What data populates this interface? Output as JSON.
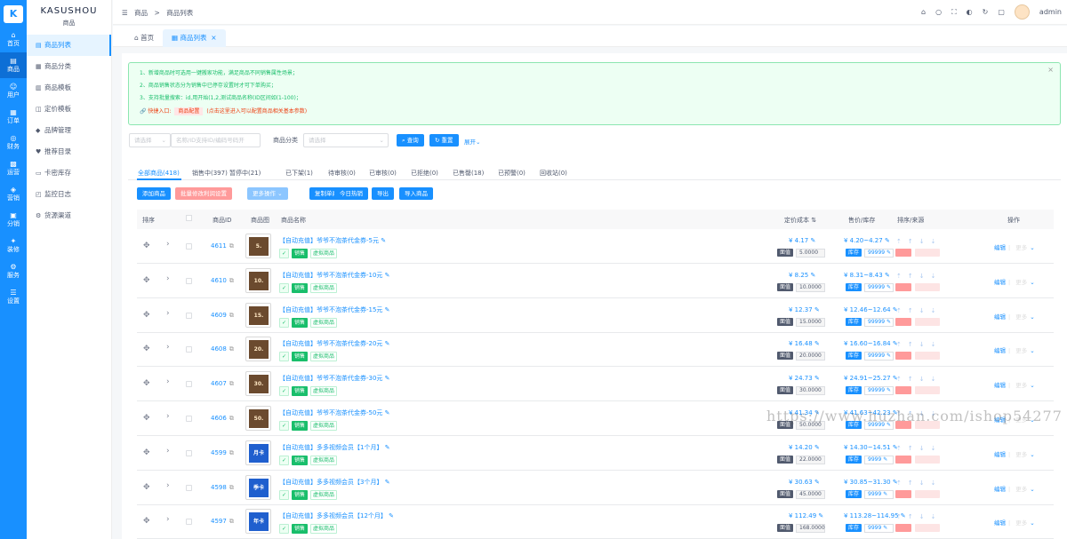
{
  "app": {
    "logo_text": "K",
    "brand": "KASUSHOU",
    "section": "商品"
  },
  "rail": [
    {
      "icon": "⌂",
      "label": "首页"
    },
    {
      "icon": "▤",
      "label": "商品"
    },
    {
      "icon": "☺",
      "label": "用户"
    },
    {
      "icon": "▦",
      "label": "订单"
    },
    {
      "icon": "◎",
      "label": "财务"
    },
    {
      "icon": "▩",
      "label": "运营"
    },
    {
      "icon": "◈",
      "label": "营销"
    },
    {
      "icon": "▣",
      "label": "分销"
    },
    {
      "icon": "✦",
      "label": "装修"
    },
    {
      "icon": "⚙",
      "label": "服务"
    },
    {
      "icon": "☰",
      "label": "设置"
    }
  ],
  "menu": [
    {
      "icon": "▤",
      "label": "商品列表"
    },
    {
      "icon": "▦",
      "label": "商品分类"
    },
    {
      "icon": "▥",
      "label": "商品模板"
    },
    {
      "icon": "◫",
      "label": "定价模板"
    },
    {
      "icon": "◆",
      "label": "品牌管理"
    },
    {
      "icon": "♥",
      "label": "推荐目录"
    },
    {
      "icon": "▭",
      "label": "卡密库存"
    },
    {
      "icon": "◰",
      "label": "监控日志"
    },
    {
      "icon": "⚙",
      "label": "货源渠道"
    }
  ],
  "breadcrumb": {
    "root": "商品",
    "sep": ">",
    "current": "商品列表"
  },
  "user": {
    "name": "admin"
  },
  "tabs": [
    {
      "label": "首页"
    },
    {
      "label": "商品列表",
      "close": "×"
    }
  ],
  "alert": {
    "line1": "1、新增商品时可选用一键搬家功能，满足商品不同销售属性场景；",
    "line2": "2、商品销售状态分为销售中已停存设置时才可下单购买；",
    "line3": "3、支持批量搜索：id,用开始(1,2,测试商品名称(ID区间如(1-100)；",
    "quick_label": "🔗 快捷入口:",
    "quick_link": "商品配置",
    "quick_note": "(点击这里进入可以配置商品相关基本参数)",
    "close": "×"
  },
  "filters": {
    "select1": "请选择",
    "search_placeholder": "名称/ID支持ID/编码号码开",
    "category_label": "商品分类",
    "category_placeholder": "请选择",
    "query": "查询",
    "reset": "重置",
    "expand": "展开"
  },
  "status_tabs": [
    "全部商品(418)",
    "销售中(397)",
    "暂停中(21)",
    "已下架(1)",
    "待审核(0)",
    "已审核(0)",
    "已拒绝(0)",
    "已售罄(18)",
    "已预警(0)",
    "回收站(0)"
  ],
  "actions": [
    "添加商品",
    "批量修改利润设置",
    "更多操作",
    "复制单商",
    "今日热销",
    "导出",
    "导入商品"
  ],
  "table_headers": {
    "sort": "排序",
    "id": "商品ID",
    "image": "商品图",
    "name": "商品名称",
    "cost": "定价成本",
    "price": "售价/库存",
    "source": "排序/来源",
    "ops": "操作"
  },
  "row_labels": {
    "sale_tag": "销售",
    "virtual_tag": "虚拟商品",
    "cost_tag": "面值",
    "stock_tag": "库存",
    "edit": "编辑",
    "more": "更多",
    "copy_icon": "⧉",
    "edit_icon": "✎"
  },
  "rows": [
    {
      "id": "4611",
      "thumb": "5.",
      "thumb_type": "coffee",
      "name": "【自动充值】爷爷不泡茶代金券-5元",
      "cost": "¥ 4.17",
      "face": "5.0000",
      "price": "¥ 4.20~4.27",
      "stock": "99999"
    },
    {
      "id": "4610",
      "thumb": "10.",
      "thumb_type": "coffee",
      "name": "【自动充值】爷爷不泡茶代金券-10元",
      "cost": "¥ 8.25",
      "face": "10.0000",
      "price": "¥ 8.31~8.43",
      "stock": "99999"
    },
    {
      "id": "4609",
      "thumb": "15.",
      "thumb_type": "coffee",
      "name": "【自动充值】爷爷不泡茶代金券-15元",
      "cost": "¥ 12.37",
      "face": "15.0000",
      "price": "¥ 12.46~12.64",
      "stock": "99999"
    },
    {
      "id": "4608",
      "thumb": "20.",
      "thumb_type": "coffee",
      "name": "【自动充值】爷爷不泡茶代金券-20元",
      "cost": "¥ 16.48",
      "face": "20.0000",
      "price": "¥ 16.60~16.84",
      "stock": "99999"
    },
    {
      "id": "4607",
      "thumb": "30.",
      "thumb_type": "coffee",
      "name": "【自动充值】爷爷不泡茶代金券-30元",
      "cost": "¥ 24.73",
      "face": "30.0000",
      "price": "¥ 24.91~25.27",
      "stock": "99999"
    },
    {
      "id": "4606",
      "thumb": "50.",
      "thumb_type": "coffee",
      "name": "【自动充值】爷爷不泡茶代金券-50元",
      "cost": "¥ 41.34",
      "face": "50.0000",
      "price": "¥ 41.63~42.23",
      "stock": "99999"
    },
    {
      "id": "4599",
      "thumb": "月卡",
      "thumb_type": "video",
      "name": "【自动充值】多多视频会员【1个月】",
      "cost": "¥ 14.20",
      "face": "22.0000",
      "price": "¥ 14.30~14.51",
      "stock": "9999"
    },
    {
      "id": "4598",
      "thumb": "季卡",
      "thumb_type": "video",
      "name": "【自动充值】多多视频会员【3个月】",
      "cost": "¥ 30.63",
      "face": "45.0000",
      "price": "¥ 30.85~31.30",
      "stock": "9999"
    },
    {
      "id": "4597",
      "thumb": "年卡",
      "thumb_type": "video",
      "name": "【自动充值】多多视频会员【12个月】",
      "cost": "¥ 112.49",
      "face": "168.0000",
      "price": "¥ 113.28~114.95",
      "stock": "9999"
    }
  ],
  "watermark": "https://www.huzhan.com/ishop54277",
  "colors": {
    "primary": "#1890ff",
    "success": "#19be6b",
    "danger": "#ed4014"
  }
}
